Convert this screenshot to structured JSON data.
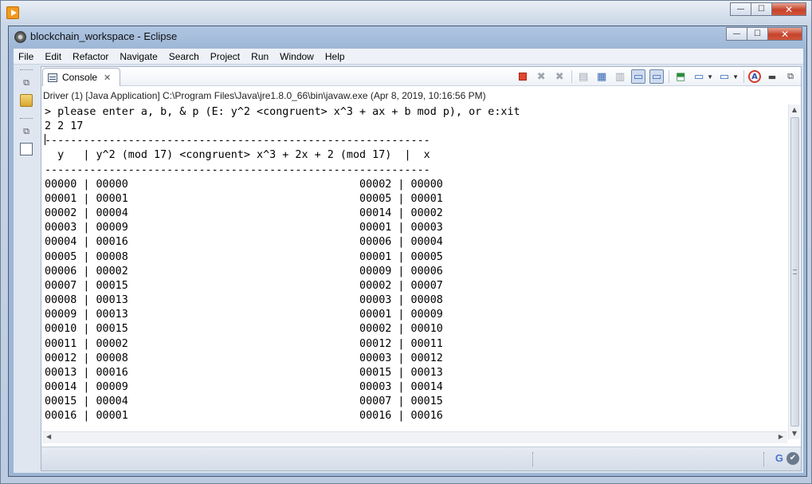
{
  "outer_window": {
    "buttons": {
      "minimize": "—",
      "maximize": "☐",
      "close": "✕"
    }
  },
  "eclipse_window": {
    "title": "blockchain_workspace - Eclipse",
    "buttons": {
      "minimize": "—",
      "maximize": "☐",
      "close": "✕"
    }
  },
  "menubar": {
    "items": [
      "File",
      "Edit",
      "Refactor",
      "Navigate",
      "Search",
      "Project",
      "Run",
      "Window",
      "Help"
    ]
  },
  "console_view": {
    "tab_label": "Console",
    "tab_close": "✕",
    "process_label": "Driver (1) [Java Application] C:\\Program Files\\Java\\jre1.8.0_66\\bin\\javaw.exe (Apr 8, 2019, 10:16:56 PM)",
    "toolbar_icons": [
      "terminate-icon",
      "remove-launch-icon",
      "remove-all-icon",
      "clear-console-icon",
      "scroll-lock-icon",
      "word-wrap-icon",
      "show-stdout-icon",
      "show-stderr-icon",
      "pin-console-icon",
      "display-console-icon",
      "open-console-icon",
      "new-console-icon",
      "minimize-icon",
      "maximize-icon"
    ]
  },
  "console_output": {
    "prompt": "> please enter a, b, & p (E: y^2 <congruent> x^3 + ax + b mod p), or e:xit",
    "input": "2 2 17",
    "separator": "------------------------------------------------------------",
    "header": "  y   | y^2 (mod 17) <congruent> x^3 + 2x + 2 (mod 17)  |  x",
    "rows": [
      "00000 | 00000                                    00002 | 00000",
      "00001 | 00001                                    00005 | 00001",
      "00002 | 00004                                    00014 | 00002",
      "00003 | 00009                                    00001 | 00003",
      "00004 | 00016                                    00006 | 00004",
      "00005 | 00008                                    00001 | 00005",
      "00006 | 00002                                    00009 | 00006",
      "00007 | 00015                                    00002 | 00007",
      "00008 | 00013                                    00003 | 00008",
      "00009 | 00013                                    00001 | 00009",
      "00010 | 00015                                    00002 | 00010",
      "00011 | 00002                                    00012 | 00011",
      "00012 | 00008                                    00003 | 00012",
      "00013 | 00016                                    00015 | 00013",
      "00014 | 00009                                    00003 | 00014",
      "00015 | 00004                                    00007 | 00015",
      "00016 | 00001                                    00016 | 00016"
    ]
  },
  "status_bar": {
    "google_label": "G",
    "check_label": "✔"
  },
  "colors": {
    "terminate": "#e2452f",
    "title_bar": "#9db6d6"
  }
}
